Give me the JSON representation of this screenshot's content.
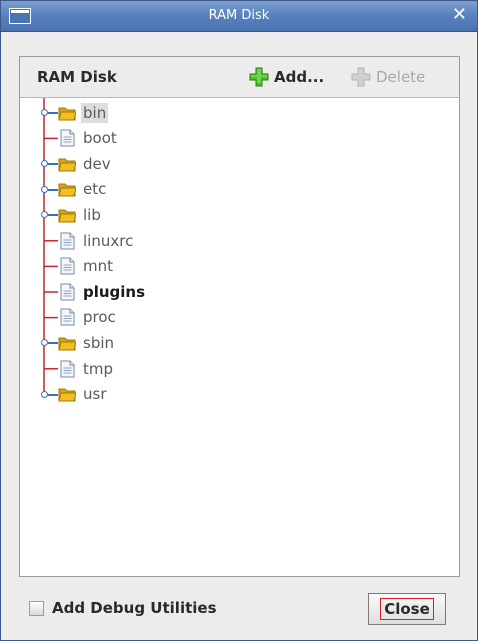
{
  "window": {
    "title": "RAM Disk",
    "close_glyph": "✕"
  },
  "panel": {
    "title": "RAM Disk",
    "add_label": "Add...",
    "delete_label": "Delete",
    "add_icon": "green-plus-icon",
    "delete_icon": "gray-plus-icon"
  },
  "tree": {
    "items": [
      {
        "label": "bin",
        "type": "folder",
        "expandable": true,
        "selected": true,
        "bold": false
      },
      {
        "label": "boot",
        "type": "file",
        "expandable": false,
        "selected": false,
        "bold": false
      },
      {
        "label": "dev",
        "type": "folder",
        "expandable": true,
        "selected": false,
        "bold": false
      },
      {
        "label": "etc",
        "type": "folder",
        "expandable": true,
        "selected": false,
        "bold": false
      },
      {
        "label": "lib",
        "type": "folder",
        "expandable": true,
        "selected": false,
        "bold": false
      },
      {
        "label": "linuxrc",
        "type": "file",
        "expandable": false,
        "selected": false,
        "bold": false
      },
      {
        "label": "mnt",
        "type": "file",
        "expandable": false,
        "selected": false,
        "bold": false
      },
      {
        "label": "plugins",
        "type": "file",
        "expandable": false,
        "selected": false,
        "bold": true
      },
      {
        "label": "proc",
        "type": "file",
        "expandable": false,
        "selected": false,
        "bold": false
      },
      {
        "label": "sbin",
        "type": "folder",
        "expandable": true,
        "selected": false,
        "bold": false
      },
      {
        "label": "tmp",
        "type": "file",
        "expandable": false,
        "selected": false,
        "bold": false
      },
      {
        "label": "usr",
        "type": "folder",
        "expandable": true,
        "selected": false,
        "bold": false
      }
    ]
  },
  "footer": {
    "debug_label": "Add Debug Utilities",
    "debug_checked": false,
    "close_label": "Close"
  },
  "colors": {
    "titlebar": "#5a82bd",
    "tree_line": "#c0282d",
    "expander": "#3b6fb8",
    "folder": "#f0c020",
    "focus_ring": "#d02020"
  }
}
